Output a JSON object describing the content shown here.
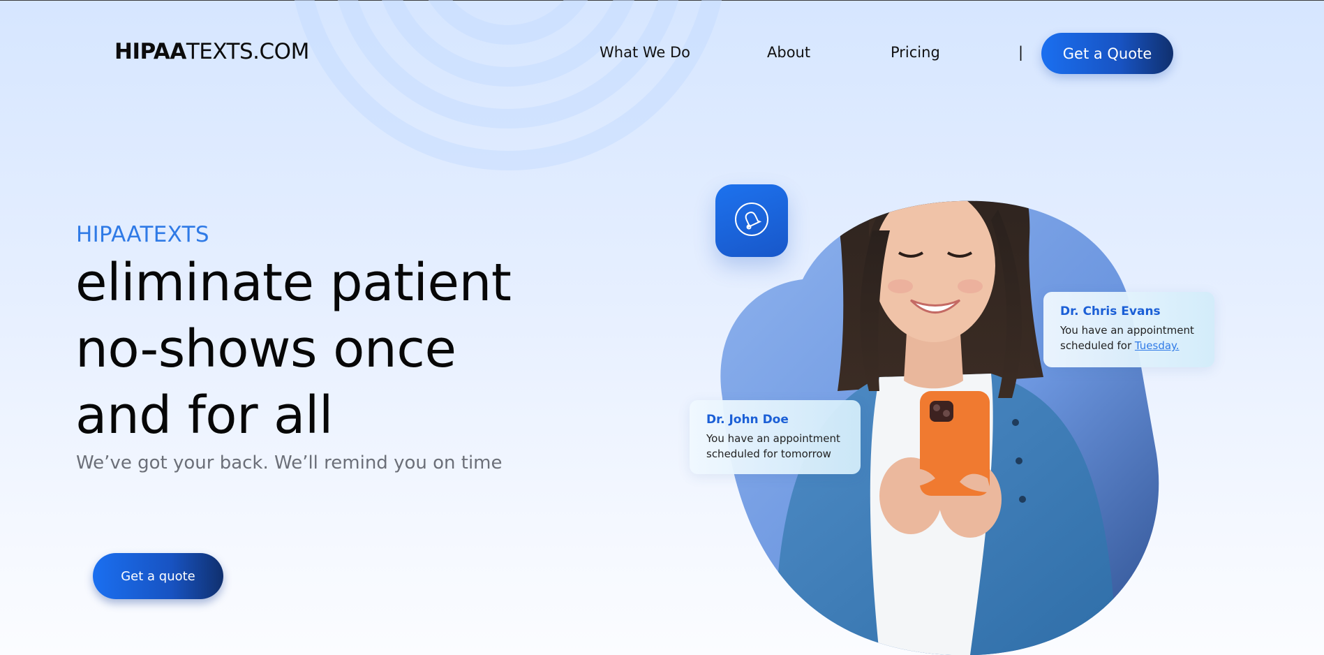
{
  "header": {
    "logo_bold": "HIPAA",
    "logo_rest": "TEXTS.COM",
    "nav": [
      {
        "label": "What We Do"
      },
      {
        "label": "About"
      },
      {
        "label": "Pricing"
      }
    ],
    "separator": "|",
    "cta_label": "Get a Quote"
  },
  "hero": {
    "eyebrow": "HIPAATEXTS",
    "headline_lines": [
      "eliminate patient",
      "no-shows once",
      "and for all"
    ],
    "subtitle": "We’ve got your back. We’ll remind you on time",
    "cta_label": "Get a quote"
  },
  "notifications": {
    "chris": {
      "name": "Dr. Chris Evans",
      "line1": "You have an appointment",
      "line2_prefix": "scheduled for ",
      "line2_link": "Tuesday."
    },
    "john": {
      "name": "Dr. John Doe",
      "line1": "You have an appointment",
      "line2": "scheduled for tomorrow"
    }
  },
  "icons": {
    "bell": "bell-icon",
    "hero_photo": "smiling-woman-holding-phone"
  },
  "colors": {
    "accent": "#2f7ae6",
    "button_start": "#1a6ff0",
    "button_end": "#10306e",
    "card_name": "#1b5fd6",
    "subtitle": "#6b6f78"
  }
}
